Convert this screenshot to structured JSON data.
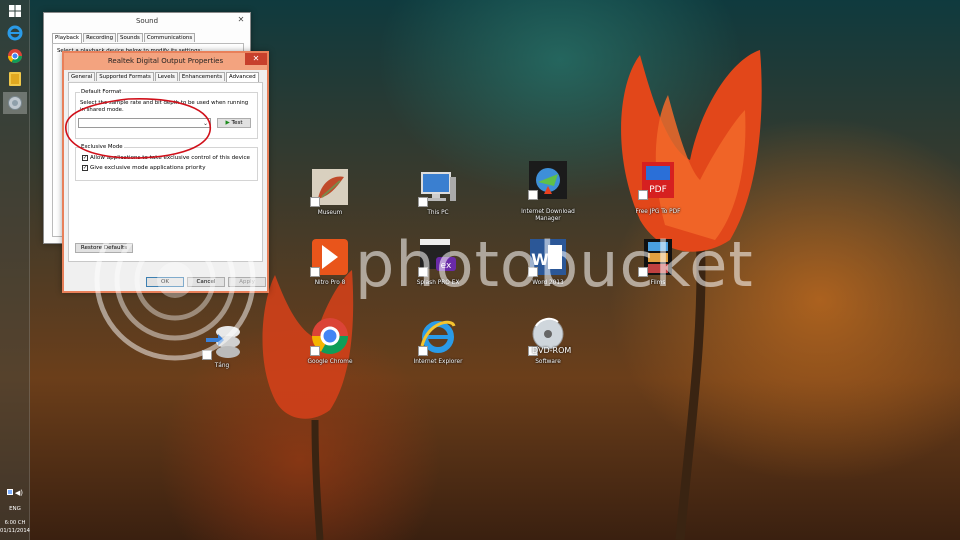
{
  "watermark": {
    "text": "photobucket"
  },
  "taskbar": {
    "tray_language": "ENG",
    "clock_time": "6:00 CH",
    "clock_date": "01/11/2014"
  },
  "desktop": {
    "icons": [
      {
        "label": "Museum",
        "icon": "museum-icon"
      },
      {
        "label": "This PC",
        "icon": "computer-icon"
      },
      {
        "label": "Internet Download Manager",
        "icon": "idm-icon"
      },
      {
        "label": "Free JPG To PDF",
        "icon": "jpg-pdf-icon"
      },
      {
        "label": "Nitro Pro 8",
        "icon": "nitro-icon"
      },
      {
        "label": "Splash PRO EX",
        "icon": "splash-icon"
      },
      {
        "label": "Word 2013",
        "icon": "word-icon"
      },
      {
        "label": "Films",
        "icon": "films-icon"
      },
      {
        "label": "Tầng",
        "icon": "tang-icon"
      },
      {
        "label": "Google Chrome",
        "icon": "chrome-icon"
      },
      {
        "label": "Internet Explorer",
        "icon": "ie-icon"
      },
      {
        "label": "Software",
        "icon": "dvd-icon"
      }
    ],
    "dvd_overlay": "DVD-ROM"
  },
  "sound_window": {
    "title": "Sound",
    "tabs": [
      "Playback",
      "Recording",
      "Sounds",
      "Communications"
    ],
    "selected_tab": "Playback",
    "partial_text": "Select a playback device below to modify its settings:"
  },
  "realtek_dialog": {
    "title": "Realtek Digital Output Properties",
    "tabs": [
      "General",
      "Supported Formats",
      "Levels",
      "Enhancements",
      "Advanced"
    ],
    "selected_tab": "Advanced",
    "default_format": {
      "group_title": "Default Format",
      "description": "Select the sample rate and bit depth to be used when running in shared mode.",
      "combo_value": "",
      "test_button": "Test"
    },
    "exclusive_mode": {
      "group_title": "Exclusive Mode",
      "allow_exclusive": "Allow applications to take exclusive control of this device",
      "give_priority": "Give exclusive mode applications priority"
    },
    "restore_defaults": "Restore Defaults",
    "ok": "OK",
    "cancel": "Cancel",
    "apply": "Apply"
  },
  "colors": {
    "dialog_border": "#e8805a",
    "annotation_red": "#d0101a",
    "close_red": "#c7402c"
  }
}
